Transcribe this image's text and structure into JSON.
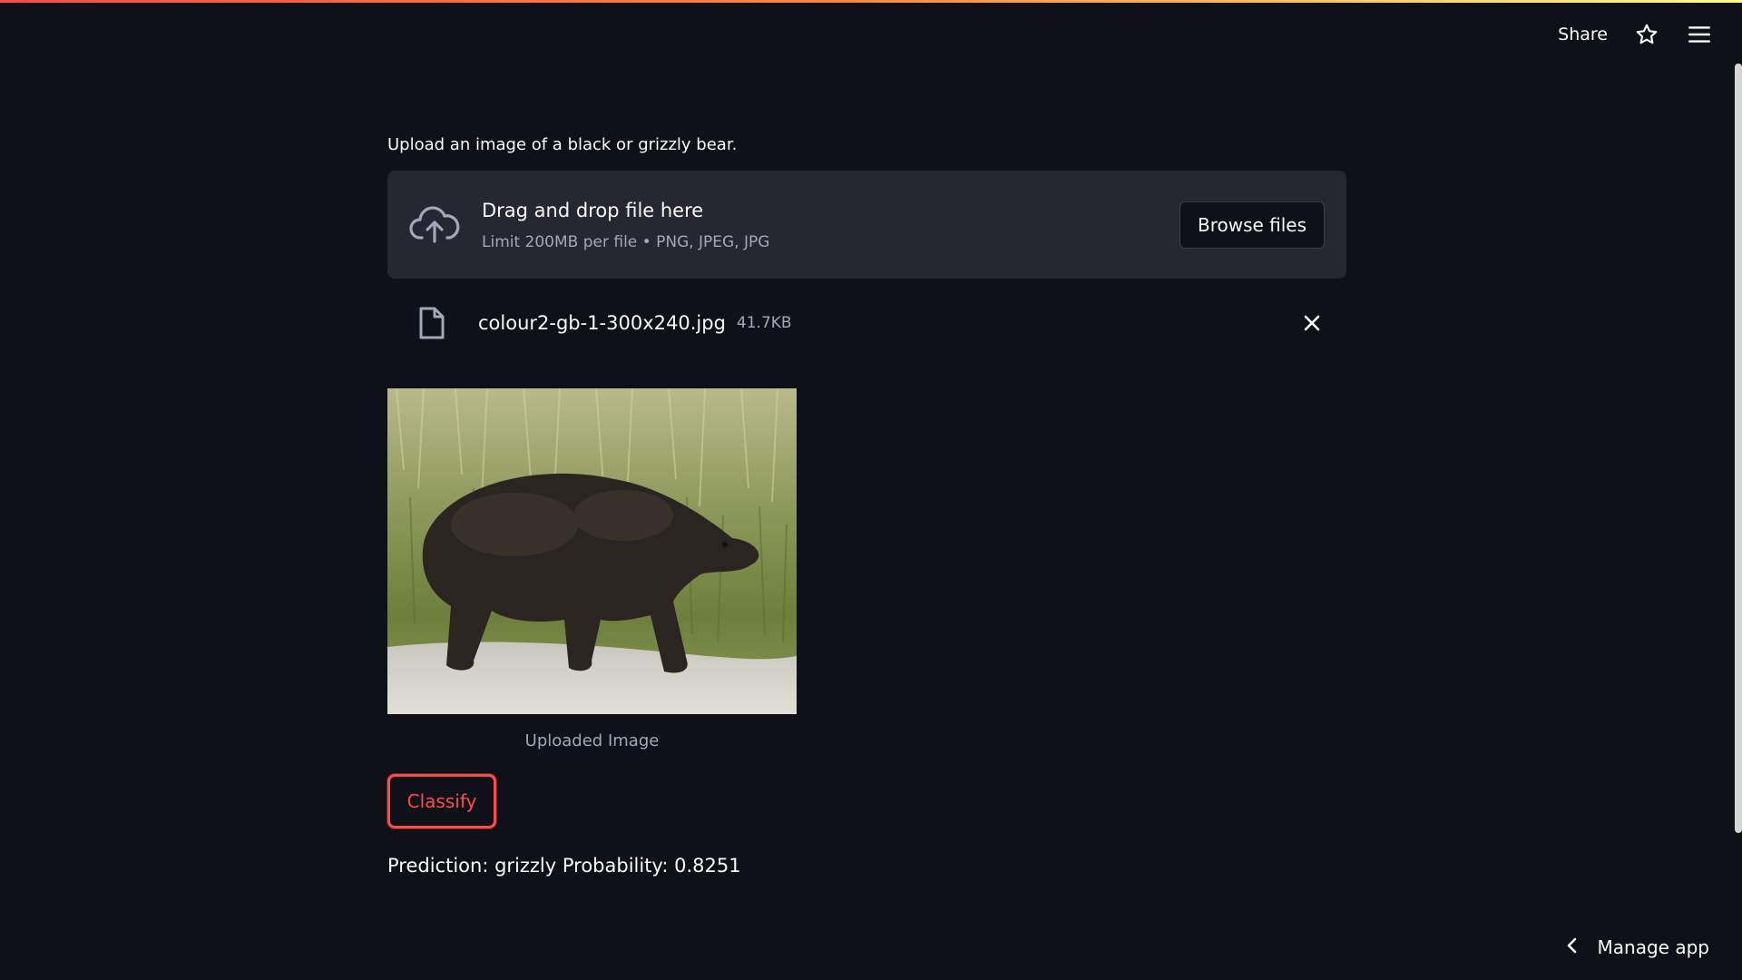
{
  "header": {
    "share_label": "Share",
    "star_icon": "star-icon",
    "menu_icon": "hamburger-menu-icon"
  },
  "uploader": {
    "label": "Upload an image of a black or grizzly bear.",
    "drop_title": "Drag and drop file here",
    "drop_subtitle": "Limit 200MB per file • PNG, JPEG, JPG",
    "browse_label": "Browse files",
    "upload_icon": "cloud-upload-icon"
  },
  "file": {
    "name": "colour2-gb-1-300x240.jpg",
    "size": "41.7KB",
    "file_icon": "file-icon",
    "remove_icon": "close-icon"
  },
  "image": {
    "caption": "Uploaded Image"
  },
  "actions": {
    "classify_label": "Classify"
  },
  "result": {
    "prediction_text": "Prediction: grizzly Probability: 0.8251"
  },
  "footer": {
    "manage_label": "Manage app",
    "chevron_icon": "chevron-left-icon"
  },
  "colors": {
    "background": "#0e1117",
    "panel": "#262730",
    "accent": "#ff4b4b",
    "muted_text": "#a3a8b8",
    "text": "#fafafa"
  }
}
